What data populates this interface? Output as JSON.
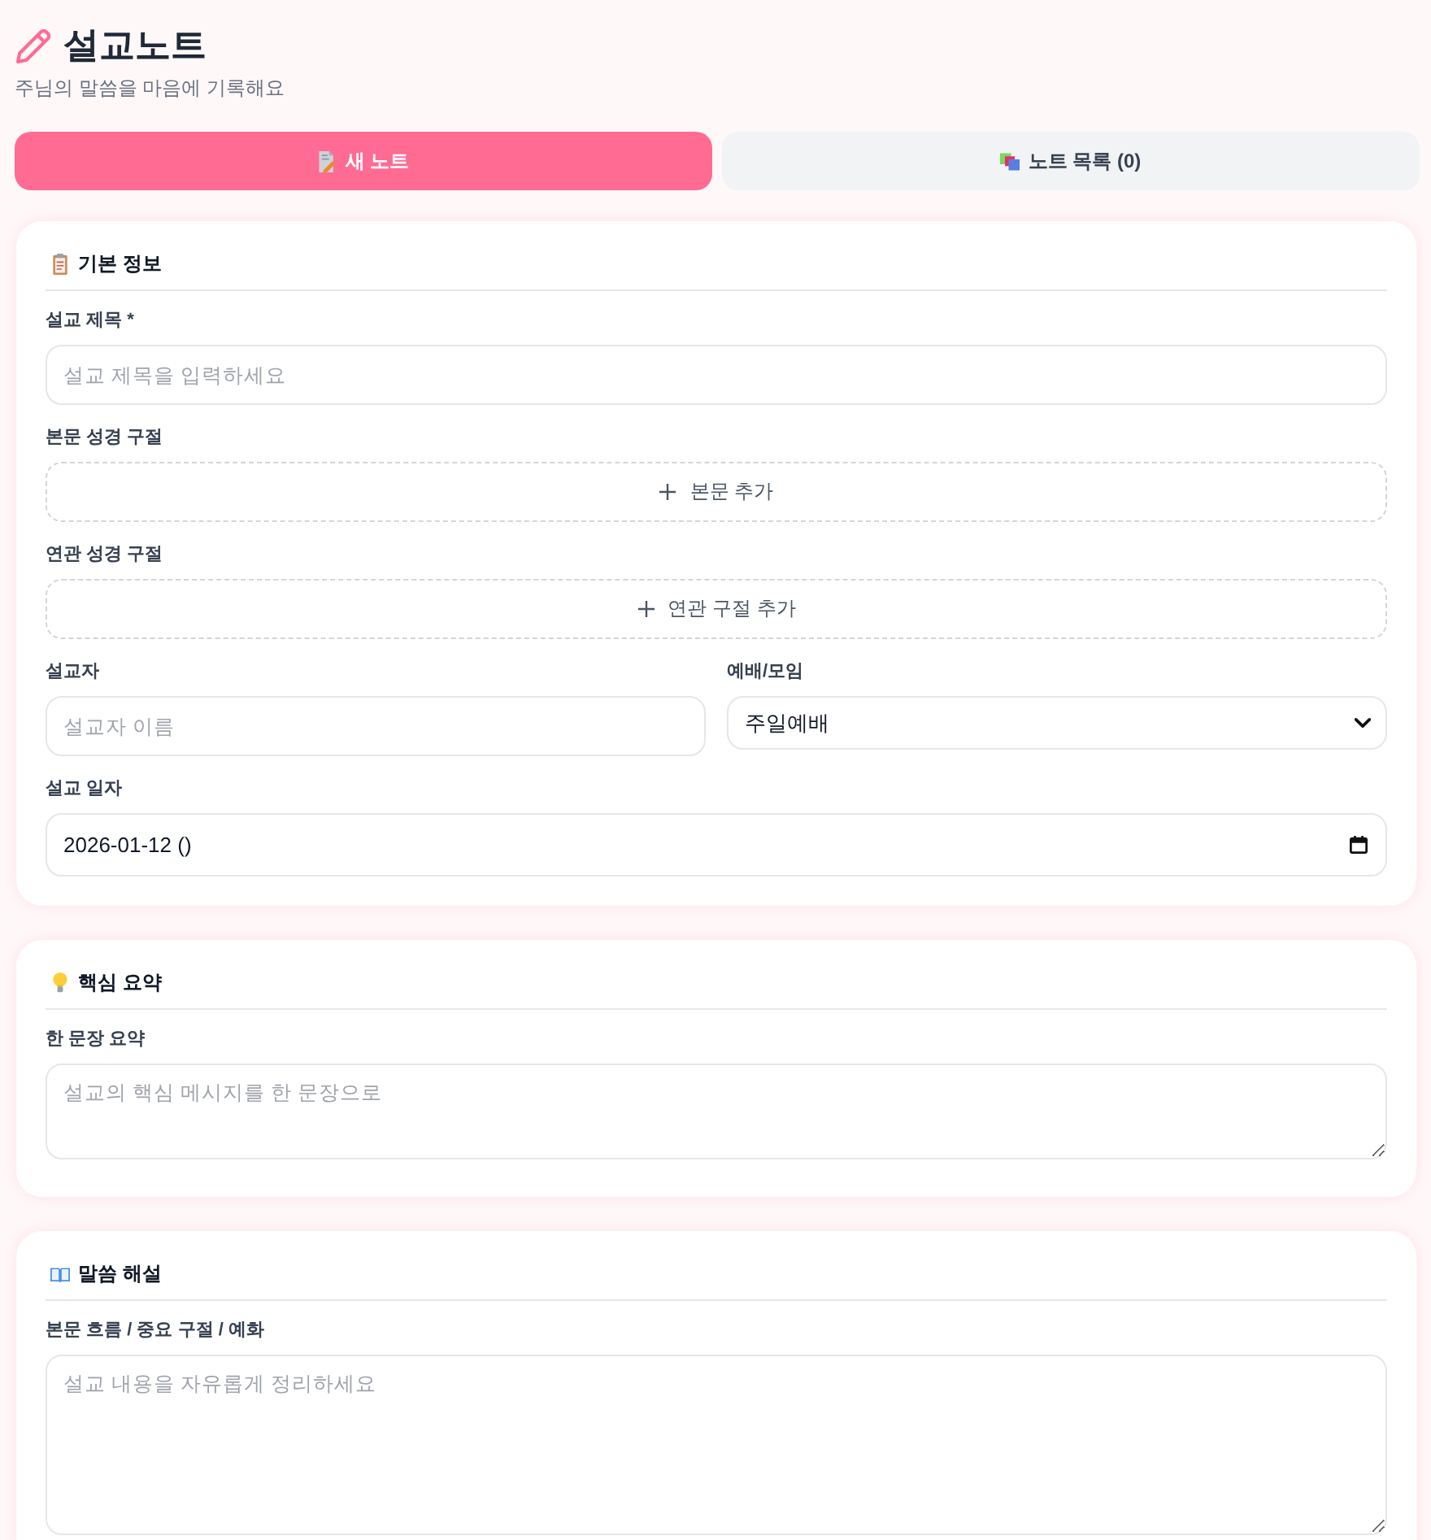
{
  "header": {
    "title": "설교노트",
    "subtitle": "주님의 말씀을 마음에 기록해요"
  },
  "tabs": [
    {
      "label": "새 노트",
      "selected": true
    },
    {
      "label": "노트 목록 (0)",
      "selected": false
    }
  ],
  "sections": [
    {
      "title": "기본 정보",
      "fields": [
        {
          "kind": "text",
          "label": "설교 제목 *",
          "placeholder": "설교 제목을 입력하세요"
        },
        {
          "kind": "add",
          "label": "본문 성경 구절",
          "button": "본문 추가"
        },
        {
          "kind": "add",
          "label": "연관 성경 구절",
          "button": "연관 구절 추가"
        },
        {
          "kind": "row",
          "fields": [
            {
              "kind": "text",
              "label": "설교자",
              "placeholder": "설교자 이름"
            },
            {
              "kind": "select",
              "label": "예배/모임",
              "value": "주일예배"
            }
          ]
        },
        {
          "kind": "date",
          "label": "설교 일자",
          "value": "2026-01-12 ()"
        }
      ]
    },
    {
      "title": "핵심 요약",
      "fields": [
        {
          "kind": "textarea",
          "label": "한 문장 요약",
          "placeholder": "설교의 핵심 메시지를 한 문장으로"
        }
      ]
    },
    {
      "title": "말씀 해설",
      "fields": [
        {
          "kind": "textarea",
          "label": "본문 흐름 / 중요 구절 / 예화",
          "placeholder": "설교 내용을 자유롭게 정리하세요"
        }
      ]
    }
  ]
}
